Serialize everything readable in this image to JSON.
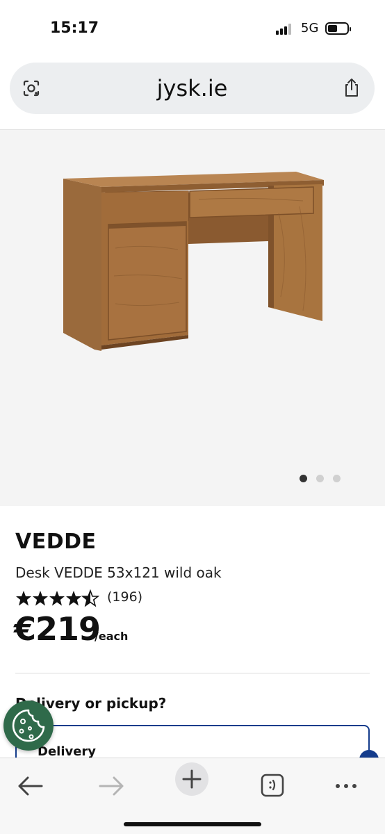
{
  "status_bar": {
    "time": "15:17",
    "network": "5G"
  },
  "browser": {
    "url": "jysk.ie"
  },
  "gallery": {
    "image_count": 3,
    "active_index": 0
  },
  "product": {
    "brand": "VEDDE",
    "name": "Desk VEDDE 53x121 wild oak",
    "rating": 4.5,
    "review_count": "(196)",
    "price": "€219",
    "unit": "/each"
  },
  "delivery": {
    "question": "Delivery or pickup?",
    "option_label": "Delivery"
  },
  "colors": {
    "accent": "#143c8c",
    "cookie_button": "#2f6a4a"
  },
  "icons": [
    "lens-icon",
    "share-icon",
    "back-arrow-icon",
    "forward-arrow-icon",
    "new-tab-plus-icon",
    "tabs-icon",
    "more-icon",
    "cookie-icon"
  ]
}
